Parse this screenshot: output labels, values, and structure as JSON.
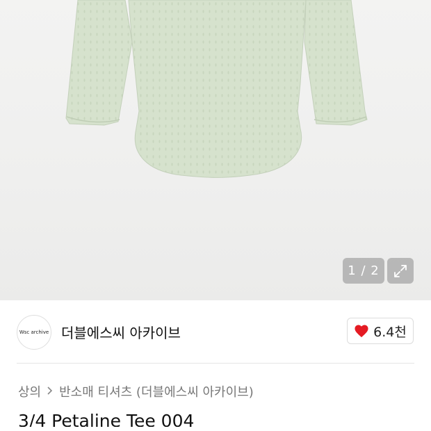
{
  "gallery": {
    "counter": "1 / 2",
    "expand_icon": "expand-arrows-icon"
  },
  "seller": {
    "avatar_text": "Wsc archive",
    "name": "더블에스씨 아카이브"
  },
  "like": {
    "icon": "heart-icon",
    "color": "#e51b23",
    "count": "6.4천"
  },
  "breadcrumb": {
    "items": [
      "상의",
      "반소매 티셔츠 (더블에스씨 아카이브)"
    ]
  },
  "product": {
    "title": "3/4 Petaline Tee 004"
  },
  "colors": {
    "shirt": "#d5e1cc"
  }
}
